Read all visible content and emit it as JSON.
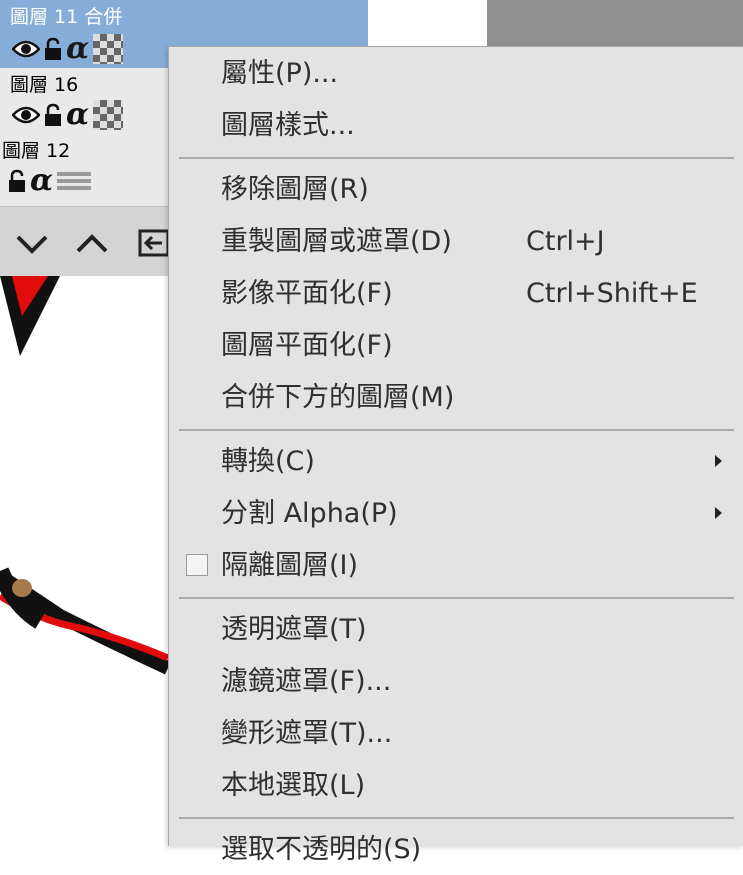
{
  "layers_panel": {
    "layers": [
      {
        "name": "圖層 11 合併",
        "selected": true,
        "visible": true,
        "alpha": "α",
        "thumb": "checker"
      },
      {
        "name": "圖層 16",
        "selected": false,
        "visible": true,
        "alpha": "α",
        "thumb": "checker"
      },
      {
        "name": "圖層 12",
        "selected": false,
        "visible": false,
        "alpha": "α",
        "thumb": "blend"
      }
    ]
  },
  "context_menu": {
    "items": [
      {
        "label": "屬性(P)...",
        "shortcut": "",
        "submenu": false,
        "checkbox": false
      },
      {
        "label": "圖層樣式...",
        "shortcut": "",
        "submenu": false,
        "checkbox": false
      },
      {
        "separator": true
      },
      {
        "label": "移除圖層(R)",
        "shortcut": "",
        "submenu": false,
        "checkbox": false
      },
      {
        "label": "重製圖層或遮罩(D)",
        "shortcut": "Ctrl+J",
        "submenu": false,
        "checkbox": false
      },
      {
        "label": "影像平面化(F)",
        "shortcut": "Ctrl+Shift+E",
        "submenu": false,
        "checkbox": false
      },
      {
        "label": "圖層平面化(F)",
        "shortcut": "",
        "submenu": false,
        "checkbox": false
      },
      {
        "label": "合併下方的圖層(M)",
        "shortcut": "",
        "submenu": false,
        "checkbox": false
      },
      {
        "separator": true
      },
      {
        "label": "轉換(C)",
        "shortcut": "",
        "submenu": true,
        "checkbox": false
      },
      {
        "label": "分割 Alpha(P)",
        "shortcut": "",
        "submenu": true,
        "checkbox": false
      },
      {
        "label": "隔離圖層(I)",
        "shortcut": "",
        "submenu": false,
        "checkbox": true,
        "checked": false
      },
      {
        "separator": true
      },
      {
        "label": "透明遮罩(T)",
        "shortcut": "",
        "submenu": false,
        "checkbox": false
      },
      {
        "label": "濾鏡遮罩(F)...",
        "shortcut": "",
        "submenu": false,
        "checkbox": false
      },
      {
        "label": "變形遮罩(T)...",
        "shortcut": "",
        "submenu": false,
        "checkbox": false
      },
      {
        "label": "本地選取(L)",
        "shortcut": "",
        "submenu": false,
        "checkbox": false
      },
      {
        "separator": true
      },
      {
        "label": "選取不透明的(S)",
        "shortcut": "",
        "submenu": false,
        "checkbox": false
      }
    ]
  },
  "colors": {
    "selection": "#86add8",
    "menu_bg": "#e3e3e3",
    "panel_bg": "#e9e9e9",
    "canvas_red": "#e10c0c",
    "canvas_black": "#111111",
    "canvas_brown": "#a77a4c"
  }
}
